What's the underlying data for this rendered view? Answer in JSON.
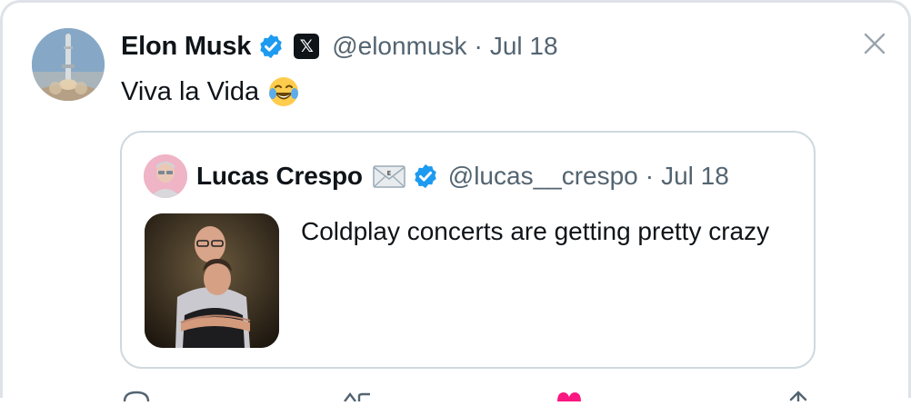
{
  "tweet": {
    "author_name": "Elon Musk",
    "verified_icon": "verified-badge-icon",
    "affiliation_icon": "x-logo-icon",
    "affiliation_glyph": "𝕏",
    "handle": "@elonmusk",
    "separator": "·",
    "date": "Jul 18",
    "text": "Viva la Vida",
    "emoji_icon": "tears-of-joy-emoji-icon",
    "close_icon": "close-icon"
  },
  "quote": {
    "author_name": "Lucas Crespo",
    "envelope_icon": "envelope-emoji-icon",
    "verified_icon": "verified-badge-icon",
    "handle": "@lucas__crespo",
    "separator": "·",
    "date": "Jul 18",
    "text": "Coldplay concerts are getting pretty crazy",
    "media": "photo-two-men-embrace"
  },
  "actions": [
    "reply-icon",
    "retweet-icon",
    "like-icon",
    "share-icon"
  ],
  "colors": {
    "text_primary": "#0f1419",
    "text_secondary": "#536471",
    "verified_blue": "#1d9bf0",
    "border": "#cfd9de",
    "like_pink": "#f91880"
  }
}
